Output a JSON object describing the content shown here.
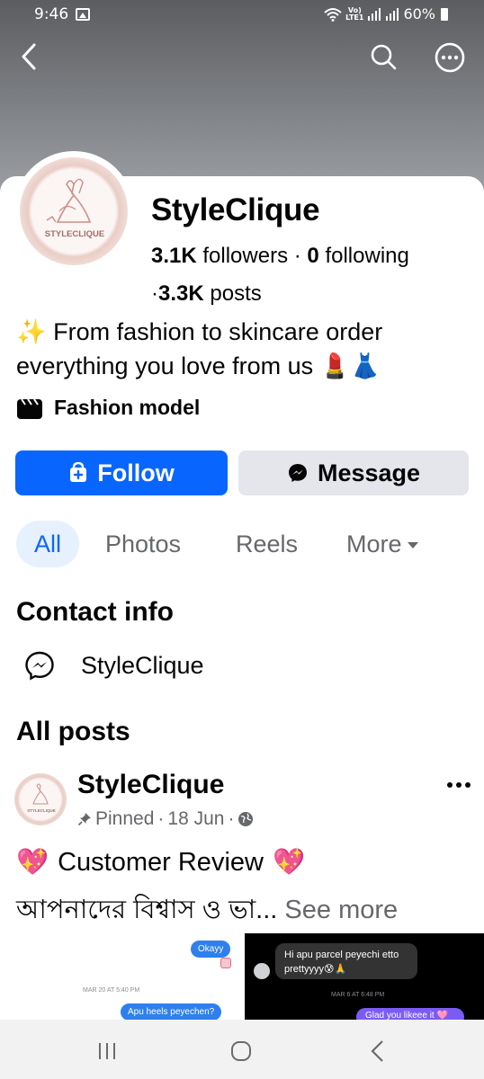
{
  "status_bar": {
    "time": "9:46",
    "network_label": "VoLTE1",
    "battery": "60%"
  },
  "profile": {
    "name": "StyleClique",
    "logo_text": "STYLECLIQUE",
    "followers_count": "3.1K",
    "followers_label": "followers",
    "following_count": "0",
    "following_label": "following",
    "posts_count": "3.3K",
    "posts_label": "posts",
    "bio_line1": "From fashion to skincare order",
    "bio_line2": "everything you love from us",
    "category": "Fashion model"
  },
  "actions": {
    "follow_label": "Follow",
    "message_label": "Message"
  },
  "tabs": {
    "all": "All",
    "photos": "Photos",
    "reels": "Reels",
    "more": "More"
  },
  "contact": {
    "title": "Contact info",
    "messenger_name": "StyleClique"
  },
  "posts": {
    "title": "All posts",
    "author": "StyleClique",
    "pinned": "Pinned",
    "date": "18 Jun",
    "line1": "Customer Review",
    "line2": "আপনাদের বিশ্বাস ও ভা...",
    "see_more": "See more",
    "chat_left": {
      "okay": "Okayy",
      "date": "MAR 20 AT 5:40 PM",
      "question": "Apu heels peyechen?"
    },
    "chat_right": {
      "message": "Hi apu parcel peyechi etto prettyyyy😰🙏",
      "date": "MAR 6 AT 6:48 PM",
      "reply": "Glad you likeee it 🩷🩷"
    }
  },
  "colors": {
    "accent": "#0866ff",
    "secondary_button": "#e4e6eb",
    "muted_text": "#65676b",
    "header_gray": "#6c6e71"
  }
}
